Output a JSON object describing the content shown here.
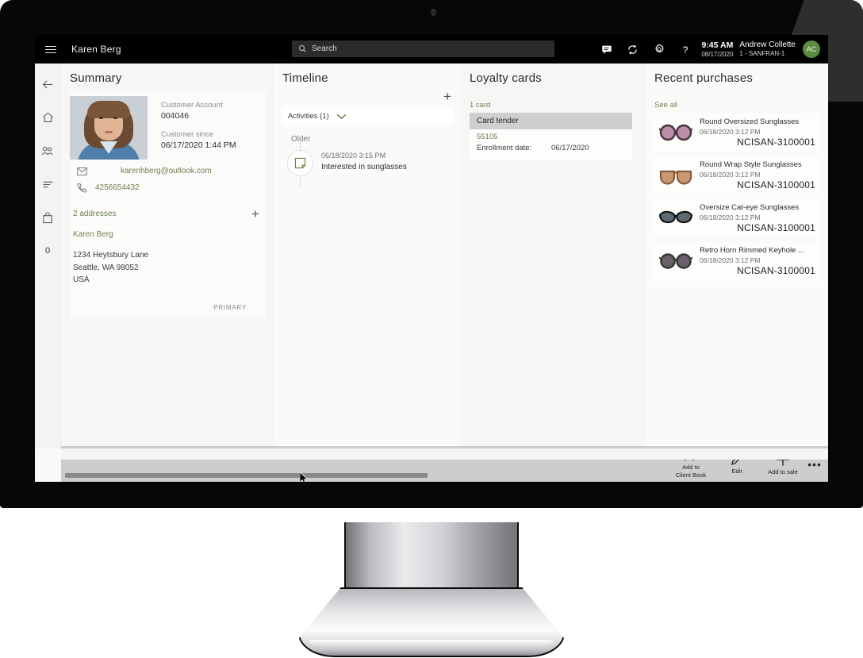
{
  "header": {
    "menu_icon": "hamburger-icon",
    "title": "Karen Berg",
    "search": {
      "icon": "search-icon",
      "placeholder": "Search"
    },
    "icons": [
      "chat-icon",
      "refresh-icon",
      "gear-icon",
      "help-icon"
    ],
    "clock": {
      "time": "9:45 AM",
      "date": "08/17/2020"
    },
    "user": {
      "name": "Andrew Collette",
      "store": "1 - SANFRAN-1",
      "initials": "AC",
      "avatar_color": "#5c8a3f"
    }
  },
  "nav_rail": {
    "items": [
      {
        "icon": "back-arrow-icon",
        "name": "back"
      },
      {
        "icon": "home-icon",
        "name": "home"
      },
      {
        "icon": "customers-icon",
        "name": "customers"
      },
      {
        "icon": "list-icon",
        "name": "tasks"
      },
      {
        "icon": "bag-icon",
        "name": "cart"
      }
    ],
    "cart_count": "0"
  },
  "summary": {
    "title": "Summary",
    "photo_alt": "customer-photo",
    "account_label": "Customer Account",
    "account_value": "004046",
    "since_label": "Customer since",
    "since_value": "06/17/2020 1:44 PM",
    "email_icon": "mail-icon",
    "email": "karenhberg@outlook.com",
    "phone_icon": "phone-icon",
    "phone": "4256654432",
    "addresses_count": "2 addresses",
    "add_address_label": "+",
    "address": {
      "name": "Karen Berg",
      "line1": "1234 Heytsbury Lane",
      "line2": "Seattle, WA 98052",
      "line3": "USA",
      "tag": "PRIMARY"
    }
  },
  "timeline": {
    "title": "Timeline",
    "add_label": "+",
    "filter_label": "Activities (1)",
    "chevron_icon": "chevron-down-icon",
    "group_label": "Older",
    "entry": {
      "icon": "note-icon",
      "date": "06/18/2020 3:15 PM",
      "text": "Interested in sunglasses"
    }
  },
  "loyalty": {
    "title": "Loyalty cards",
    "count": "1 card",
    "card_name": "Card tender",
    "card_number": "55105",
    "enrollment_label": "Enrollment date:",
    "enrollment_value": "06/17/2020"
  },
  "recent_purchases": {
    "title": "Recent purchases",
    "see_all": "See all",
    "items": [
      {
        "name": "Round Oversized Sunglasses",
        "date": "06/18/2020 3:12 PM",
        "sku": "NCISAN-3100001",
        "thumb": "round-oversized-sunglasses-icon",
        "frame_color": "#4a3340",
        "lens_color": "#b98fa8"
      },
      {
        "name": "Round Wrap Style Sunglasses",
        "date": "06/18/2020 3:12 PM",
        "sku": "NCISAN-3100001",
        "thumb": "round-wrap-sunglasses-icon",
        "frame_color": "#8b5a3c",
        "lens_color": "#c99a72"
      },
      {
        "name": "Oversize Cat-eye Sunglasses",
        "date": "06/18/2020 3:12 PM",
        "sku": "NCISAN-3100001",
        "thumb": "cat-eye-sunglasses-icon",
        "frame_color": "#141414",
        "lens_color": "#5e6a72"
      },
      {
        "name": "Retro Horn Rimmed Keyhole ...",
        "date": "06/18/2020 3:12 PM",
        "sku": "NCISAN-3100001",
        "thumb": "retro-horn-rimmed-sunglasses-icon",
        "frame_color": "#2f3b33",
        "lens_color": "#6d5f6a"
      }
    ]
  },
  "command_bar": {
    "buttons": [
      {
        "icon": "add-person-icon",
        "label": "Add to\nClient Book",
        "label_line1": "Add to",
        "label_line2": "Client Book"
      },
      {
        "icon": "pencil-icon",
        "label": "Edit",
        "label_line1": "Edit",
        "label_line2": ""
      },
      {
        "icon": "plus-icon",
        "label": "Add to sale",
        "label_line1": "Add to sale",
        "label_line2": ""
      }
    ],
    "overflow_label": "•••"
  },
  "colors": {
    "accent_green": "#6e8052",
    "avatar_green": "#5c8a3f",
    "header_black": "#000000",
    "command_bar_gray": "#cdcdcb",
    "loyalty_header_gray": "#cfcfcf"
  }
}
